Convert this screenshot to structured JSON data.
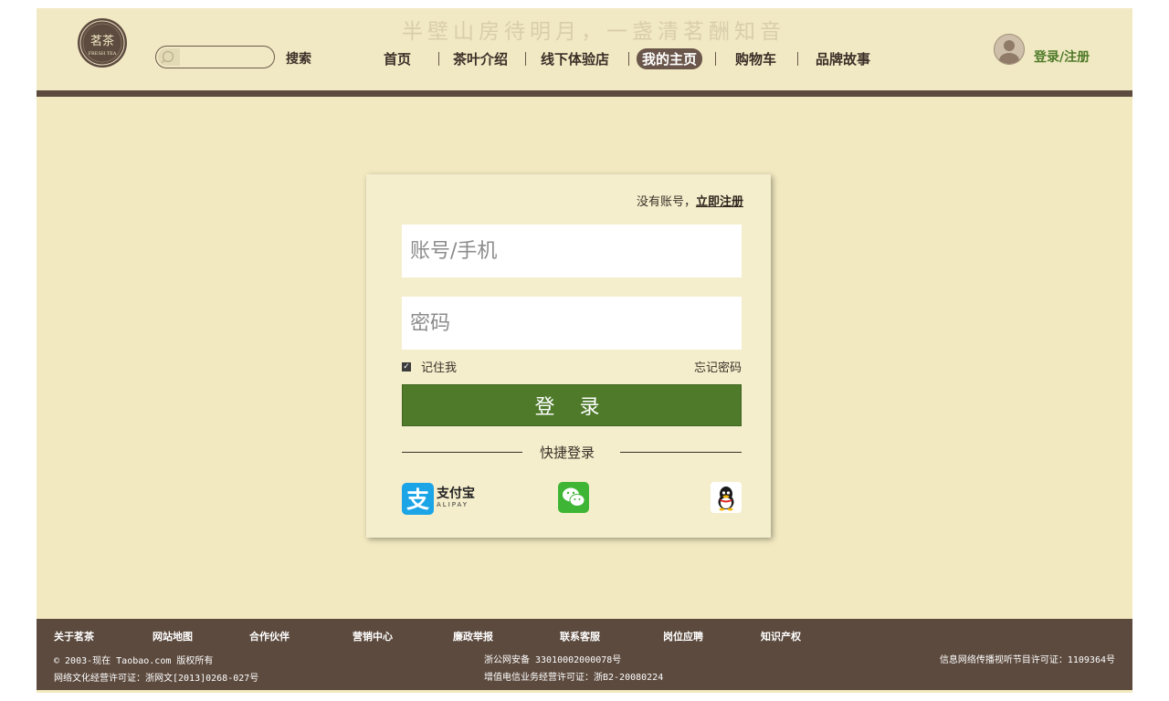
{
  "header": {
    "logo_text": "茗茶",
    "logo_sub": "FRESH TEA",
    "slogan": "半壁山房待明月，一盏清茗酬知音",
    "search": {
      "placeholder": "",
      "button_label": "搜索"
    },
    "nav": [
      "首页",
      "茶叶介绍",
      "线下体验店",
      "我的主页",
      "购物车",
      "品牌故事"
    ],
    "active_nav": "我的主页",
    "user_link": "登录/注册"
  },
  "login": {
    "no_account_text": "没有账号，",
    "register_link": "立即注册",
    "account_placeholder": "账号/手机",
    "password_placeholder": "密码",
    "remember_label": "记住我",
    "remember_checked": true,
    "forgot_label": "忘记密码",
    "submit_label": "登 录",
    "quick_login_label": "快捷登录",
    "alipay_cn": "支付宝",
    "alipay_en": "ALIPAY"
  },
  "footer": {
    "links": [
      "关于茗茶",
      "网站地图",
      "合作伙伴",
      "营销中心",
      "廉政举报",
      "联系客服",
      "岗位应聘",
      "知识产权"
    ],
    "copyright": "© 2003-现在 Taobao.com 版权所有",
    "culture_license": "网络文化经营许可证：浙网文[2013]0268-027号",
    "police_record": "浙公网安备 33010002000078号",
    "telecom_license": "增值电信业务经营许可证：浙B2-20080224",
    "av_license": "信息网络传播视听节目许可证：1109364号"
  },
  "colors": {
    "page_bg": "#f2e9c0",
    "header_rule": "#5d4b3f",
    "accent_green": "#4e7a2a",
    "footer_bg": "#5c4a3e",
    "nav_active_bg": "#6a564b"
  },
  "icons": [
    "tea-logo-icon",
    "search-icon",
    "avatar-icon",
    "checkbox-icon",
    "alipay-icon",
    "wechat-icon",
    "qq-icon"
  ]
}
